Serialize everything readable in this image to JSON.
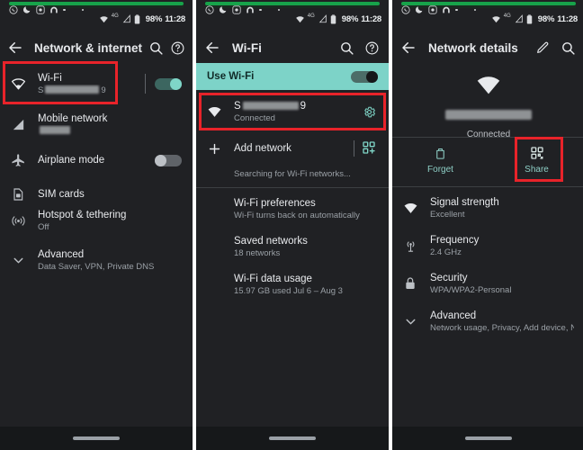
{
  "meta": {
    "accent_teal": "#7fd6c8",
    "highlight_red": "#e8232a",
    "background": "#202124",
    "banner_teal": "#7dd3c8"
  },
  "statusbar": {
    "icons": [
      "whatsapp-icon",
      "do-not-disturb-moon-icon",
      "screen-record-icon",
      "arch-icon",
      "dot-icon",
      "dot-icon"
    ],
    "wifi_icon": "wifi-icon",
    "network_type": "4G",
    "signal_icon": "cell-signal-icon",
    "battery_icon": "battery-icon",
    "battery_text": "98%",
    "time": "11:28"
  },
  "panel1": {
    "appbar": {
      "back_icon": "back-arrow-icon",
      "title": "Network & internet",
      "search_icon": "search-icon",
      "help_icon": "help-icon"
    },
    "rows": [
      {
        "icon": "wifi-icon",
        "title": "Wi-Fi",
        "sub_prefix": "S",
        "sub_suffix": "9",
        "redacted": true,
        "toggle": "on",
        "highlighted": true
      },
      {
        "icon": "cell-signal-icon",
        "title": "Mobile network",
        "sub_prefix": "",
        "sub_suffix": "",
        "redacted": true,
        "toggle": "none",
        "highlighted": false
      },
      {
        "icon": "airplane-icon",
        "title": "Airplane mode",
        "sub": "",
        "toggle": "off",
        "highlighted": false
      },
      {
        "icon": "sim-card-icon",
        "title": "SIM cards",
        "sub": "",
        "toggle": "none",
        "highlighted": false
      },
      {
        "icon": "hotspot-icon",
        "title": "Hotspot & tethering",
        "sub": "Off",
        "toggle": "none",
        "highlighted": false
      },
      {
        "icon": "chevron-down-icon",
        "title": "Advanced",
        "sub": "Data Saver, VPN, Private DNS",
        "toggle": "none",
        "highlighted": false
      }
    ]
  },
  "panel2": {
    "appbar": {
      "back_icon": "back-arrow-icon",
      "title": "Wi-Fi",
      "search_icon": "search-icon",
      "help_icon": "help-icon"
    },
    "banner": {
      "label": "Use Wi-Fi",
      "toggle": "on"
    },
    "connected": {
      "icon": "wifi-icon",
      "ssid_prefix": "S",
      "ssid_suffix": "9",
      "status": "Connected",
      "gear_icon": "gear-icon",
      "highlighted": true
    },
    "add_network": {
      "plus_icon": "plus-icon",
      "label": "Add network",
      "qr_icon": "qr-scan-icon"
    },
    "searching": "Searching for Wi-Fi networks...",
    "rows": [
      {
        "title": "Wi-Fi preferences",
        "sub": "Wi-Fi turns back on automatically"
      },
      {
        "title": "Saved networks",
        "sub": "18 networks"
      },
      {
        "title": "Wi-Fi data usage",
        "sub": "15.97 GB used Jul 6 – Aug 3"
      }
    ]
  },
  "panel3": {
    "appbar": {
      "back_icon": "back-arrow-icon",
      "title": "Network details",
      "edit_icon": "pencil-icon",
      "search_icon": "search-icon"
    },
    "header": {
      "wifi_icon": "wifi-icon",
      "ssid_redacted": true,
      "status": "Connected"
    },
    "actions": [
      {
        "icon": "trash-icon",
        "label": "Forget",
        "highlighted": false
      },
      {
        "icon": "qr-code-icon",
        "label": "Share",
        "highlighted": true
      }
    ],
    "details": [
      {
        "icon": "wifi-icon",
        "title": "Signal strength",
        "sub": "Excellent"
      },
      {
        "icon": "frequency-icon",
        "title": "Frequency",
        "sub": "2.4 GHz"
      },
      {
        "icon": "lock-icon",
        "title": "Security",
        "sub": "WPA/WPA2-Personal"
      },
      {
        "icon": "chevron-down-icon",
        "title": "Advanced",
        "sub": "Network usage, Privacy, Add device, Netwo.."
      }
    ]
  }
}
